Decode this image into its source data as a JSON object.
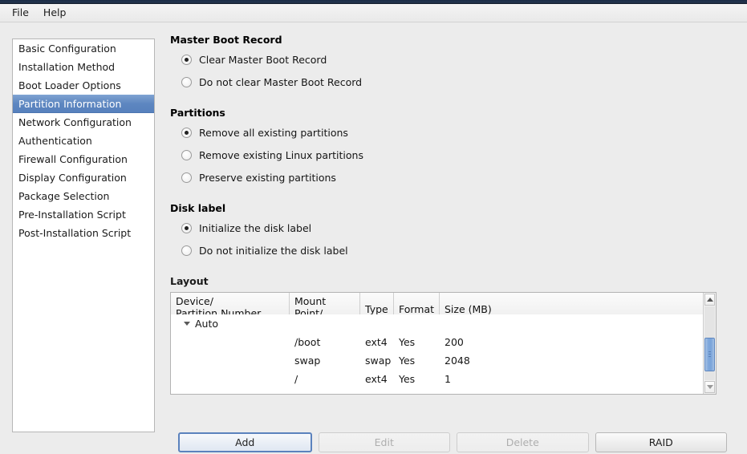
{
  "menubar": {
    "items": [
      {
        "label": "File"
      },
      {
        "label": "Help"
      }
    ]
  },
  "sidebar": {
    "items": [
      {
        "label": "Basic Configuration",
        "selected": false
      },
      {
        "label": "Installation Method",
        "selected": false
      },
      {
        "label": "Boot Loader Options",
        "selected": false
      },
      {
        "label": "Partition Information",
        "selected": true
      },
      {
        "label": "Network Configuration",
        "selected": false
      },
      {
        "label": "Authentication",
        "selected": false
      },
      {
        "label": "Firewall Configuration",
        "selected": false
      },
      {
        "label": "Display Configuration",
        "selected": false
      },
      {
        "label": "Package Selection",
        "selected": false
      },
      {
        "label": "Pre-Installation Script",
        "selected": false
      },
      {
        "label": "Post-Installation Script",
        "selected": false
      }
    ],
    "selected_color": "#5d86c0"
  },
  "sections": {
    "mbr": {
      "title": "Master Boot Record",
      "options": [
        {
          "label": "Clear Master Boot Record",
          "selected": true
        },
        {
          "label": "Do not clear Master Boot Record",
          "selected": false
        }
      ]
    },
    "partitions": {
      "title": "Partitions",
      "options": [
        {
          "label": "Remove all existing partitions",
          "selected": true
        },
        {
          "label": "Remove existing Linux partitions",
          "selected": false
        },
        {
          "label": "Preserve existing partitions",
          "selected": false
        }
      ]
    },
    "disk_label": {
      "title": "Disk label",
      "options": [
        {
          "label": "Initialize the disk label",
          "selected": true
        },
        {
          "label": "Do not initialize the disk label",
          "selected": false
        }
      ]
    }
  },
  "layout": {
    "title": "Layout",
    "columns": [
      {
        "key": "device",
        "label": "Device/\nPartition Number"
      },
      {
        "key": "mount",
        "label": "Mount Point/\nRAID"
      },
      {
        "key": "type",
        "label": "Type"
      },
      {
        "key": "format",
        "label": "Format"
      },
      {
        "key": "size",
        "label": "Size (MB)"
      }
    ],
    "rows": [
      {
        "device": "Auto",
        "mount": "",
        "type": "",
        "format": "",
        "size": "",
        "group": true,
        "expanded": true
      },
      {
        "device": "",
        "mount": "/boot",
        "type": "ext4",
        "format": "Yes",
        "size": "200",
        "group": false
      },
      {
        "device": "",
        "mount": "swap",
        "type": "swap",
        "format": "Yes",
        "size": "2048",
        "group": false
      },
      {
        "device": "",
        "mount": "/",
        "type": "ext4",
        "format": "Yes",
        "size": "1",
        "group": false
      }
    ],
    "scrollbar": {
      "thumb_color": "#7fa8dc",
      "position_pct": 42
    }
  },
  "buttons": [
    {
      "label": "Add",
      "state": "focused"
    },
    {
      "label": "Edit",
      "state": "disabled"
    },
    {
      "label": "Delete",
      "state": "disabled"
    },
    {
      "label": "RAID",
      "state": "normal"
    }
  ]
}
